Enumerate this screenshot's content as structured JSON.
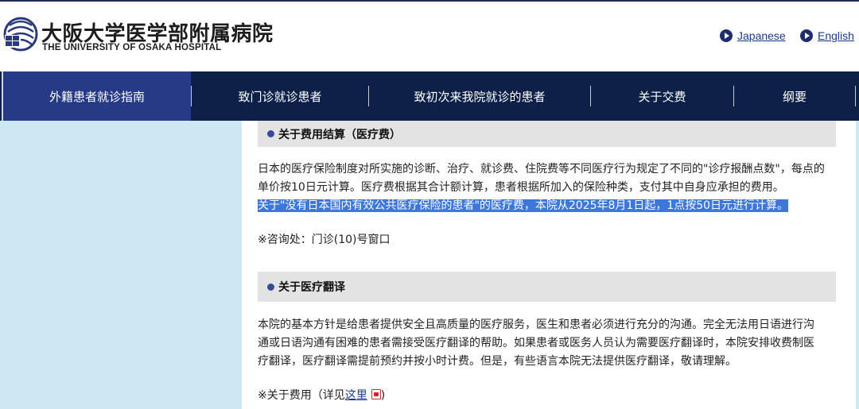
{
  "header": {
    "title_jp": "大阪大学医学部附属病院",
    "title_en": "THE UNIVERSITY OF OSAKA HOSPITAL",
    "lang_japanese": "Japanese",
    "lang_english": "English"
  },
  "nav": {
    "items": [
      "外籍患者就诊指南",
      "致门诊就诊患者",
      "致初次来我院就诊的患者",
      "关于交费",
      "纲要"
    ]
  },
  "sections": {
    "fee": {
      "heading": "关于费用结算（医疗费）",
      "line1": "日本的医疗保险制度对所实施的诊断、治疗、就诊费、住院费等不同医疗行为规定了不同的\"诊疗报酬点数\"，每点的",
      "line2": "单价按10日元计算。医疗费根据其合计额计算，患者根据所加入的保险种类，支付其中自身应承担的费用。",
      "line3_highlight": "关于\"没有日本国内有效公共医疗保险的患者\"的医疗费，本院从2025年8月1日起，1点按50日元进行计算。",
      "note": "※咨询处：门诊(10)号窗口"
    },
    "translation": {
      "heading": "关于医疗翻译",
      "line1": "本院的基本方针是给患者提供安全且高质量的医疗服务，医生和患者必须进行充分的沟通。完全无法用日语进行沟",
      "line2": "通或日语沟通有困难的患者需接受医疗翻译的帮助。如果患者或医务人员认为需要医疗翻译时，本院安排收费制医",
      "line3": "疗翻译，医疗翻译需提前预约并按小时计费。但是，有些语言本院无法提供医疗翻译，敬请理解。",
      "note_prefix": "※关于费用（详见",
      "note_link": "这里",
      "note_suffix": ")"
    }
  },
  "colors": {
    "nav_bg": "#0d2148",
    "nav_active": "#263a86",
    "sidebar_bg": "#cde8f3",
    "highlight": "#3c77d9"
  }
}
